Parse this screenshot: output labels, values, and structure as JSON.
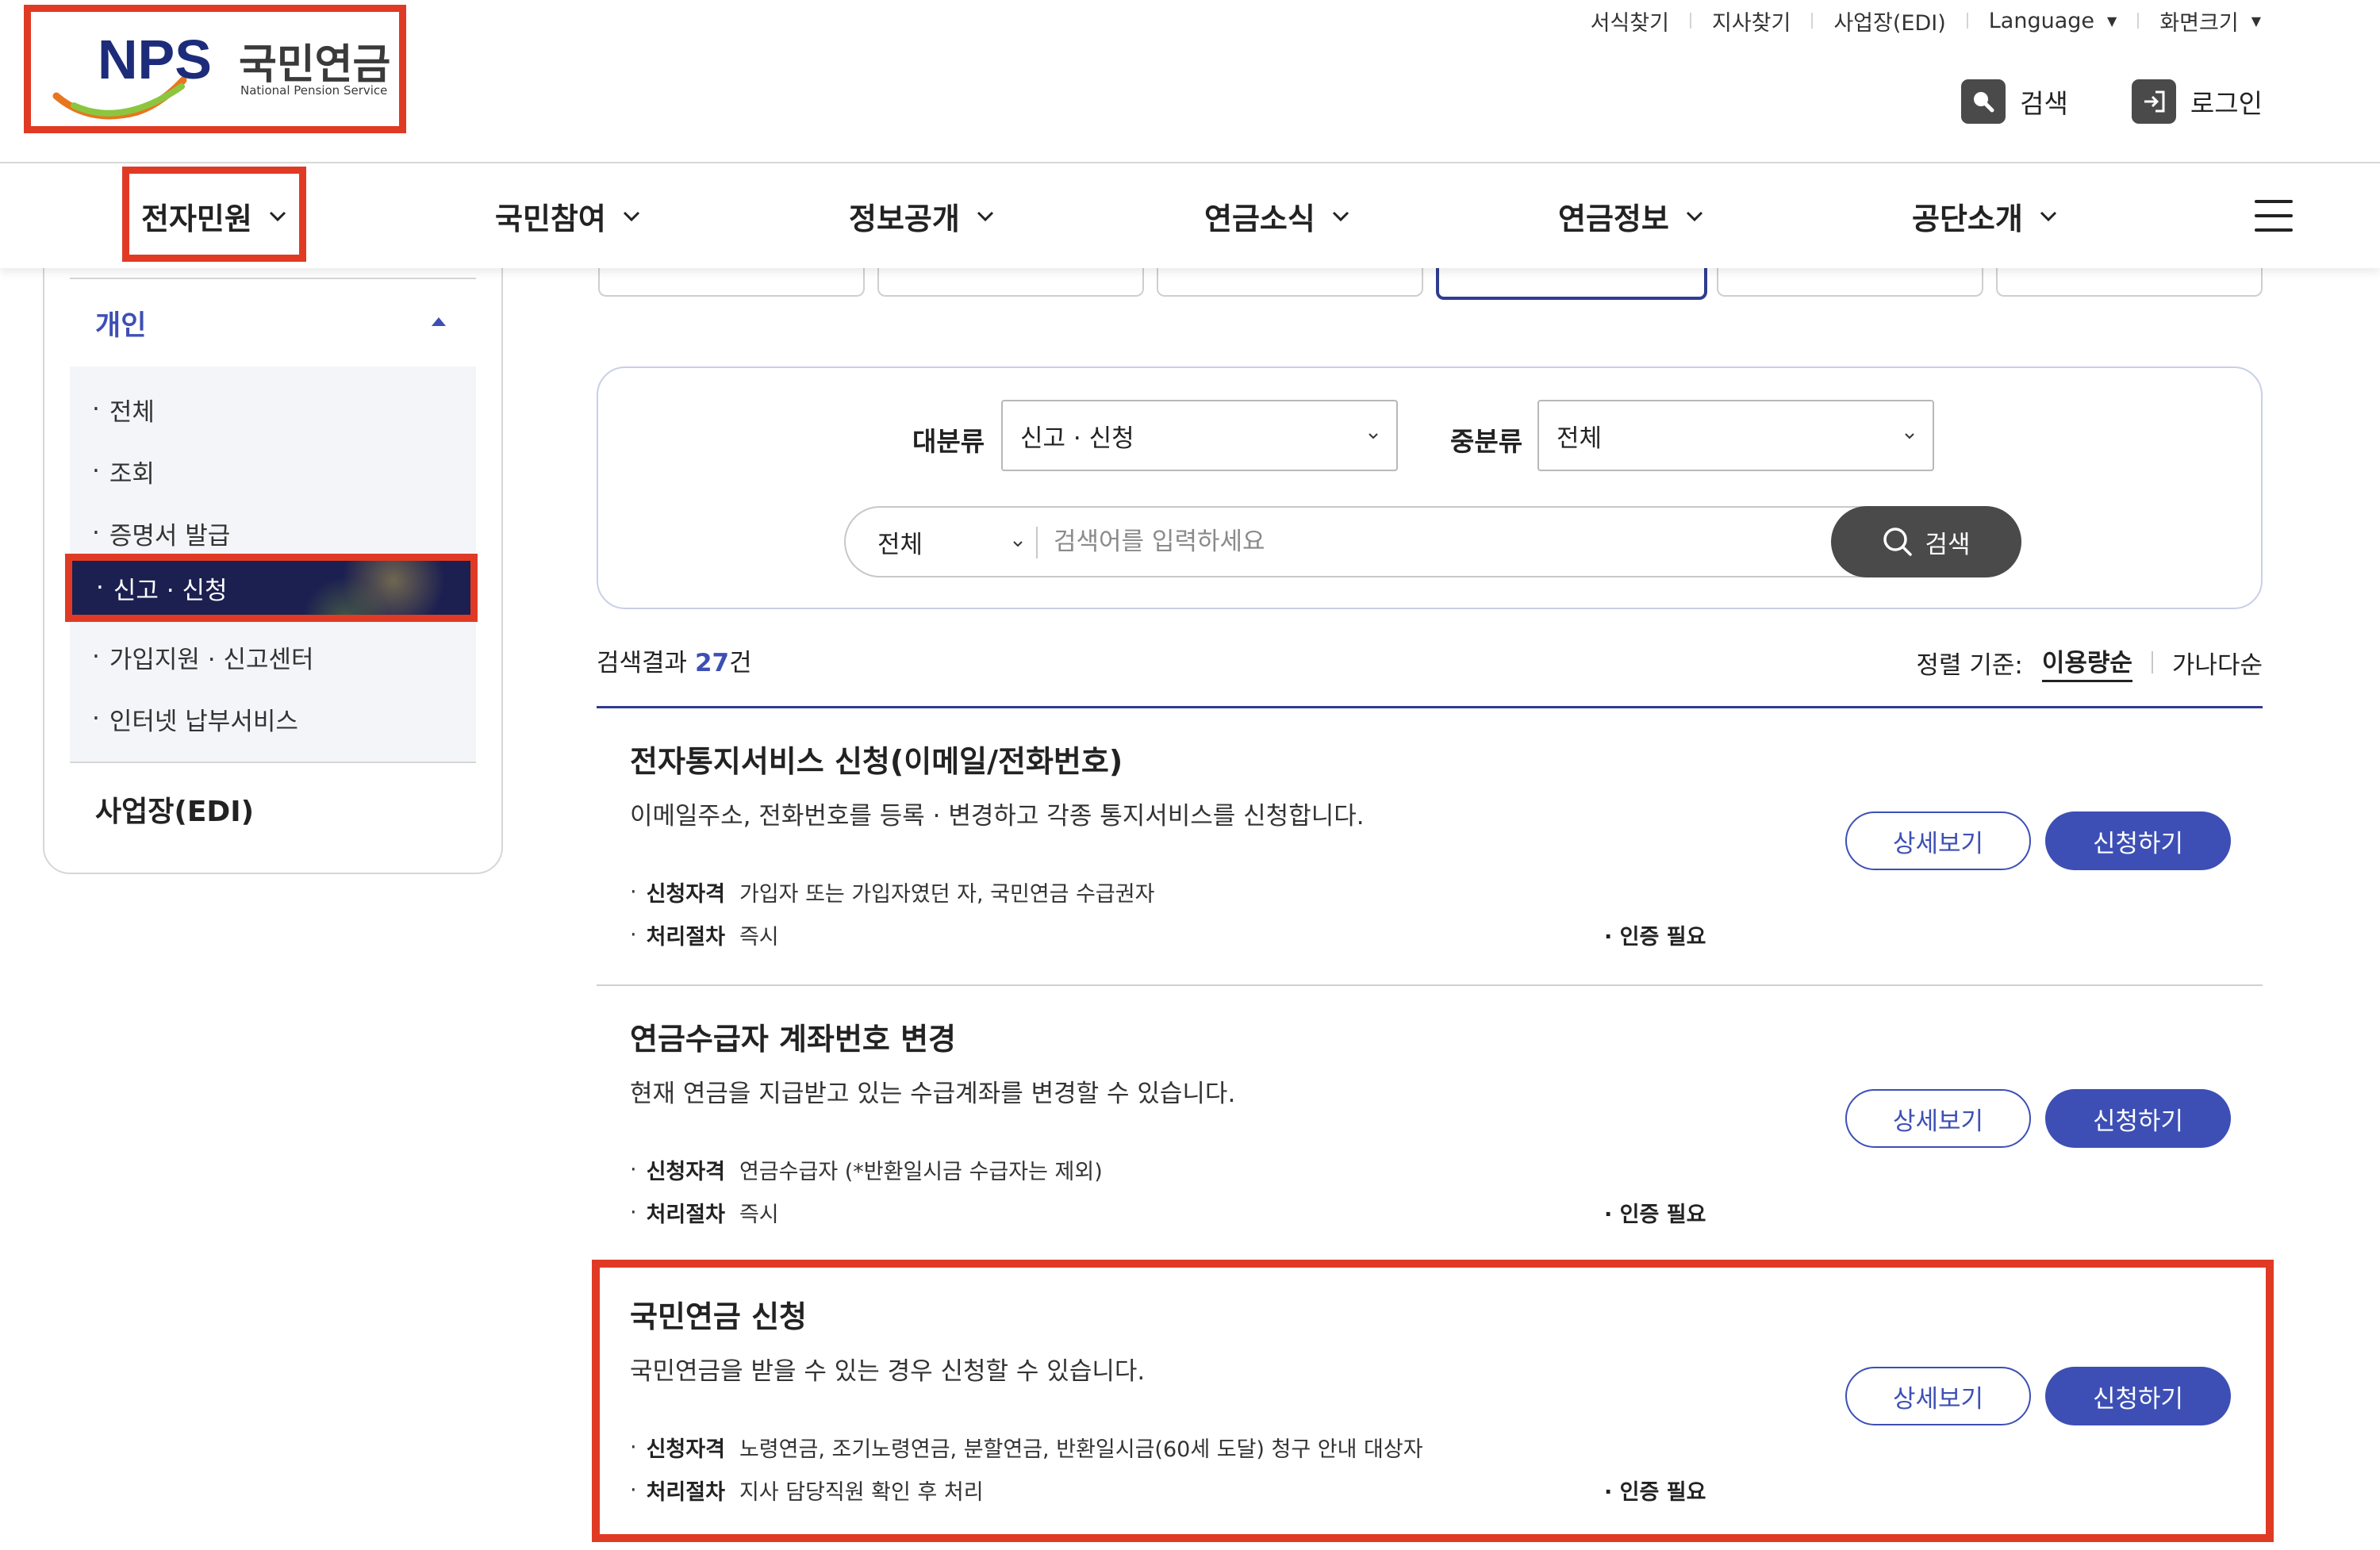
{
  "brand": {
    "logo_mark": "NPS",
    "logo_kr": "국민연금",
    "logo_en": "National Pension Service"
  },
  "utility_links": [
    {
      "label": "서식찾기",
      "has_caret": false
    },
    {
      "label": "지사찾기",
      "has_caret": false
    },
    {
      "label": "사업장(EDI)",
      "has_caret": false
    },
    {
      "label": "Language",
      "has_caret": true
    },
    {
      "label": "화면크기",
      "has_caret": true
    }
  ],
  "header_actions": {
    "search_label": "검색",
    "login_label": "로그인"
  },
  "gnb": [
    {
      "label": "전자민원"
    },
    {
      "label": "국민참여"
    },
    {
      "label": "정보공개"
    },
    {
      "label": "연금소식"
    },
    {
      "label": "연금정보"
    },
    {
      "label": "공단소개"
    }
  ],
  "sidebar": {
    "section_title": "개인",
    "items": [
      {
        "label": "전체"
      },
      {
        "label": "조회"
      },
      {
        "label": "증명서 발급"
      },
      {
        "label": "신고 · 신청"
      },
      {
        "label": "가입지원 · 신고센터"
      },
      {
        "label": "인터넷 납부서비스"
      }
    ],
    "active_index": 3,
    "second_section": "사업장(EDI)"
  },
  "filters": {
    "major_label": "대분류",
    "major_value": "신고 · 신청",
    "minor_label": "중분류",
    "minor_value": "전체",
    "scope_value": "전체",
    "search_placeholder": "검색어를 입력하세요",
    "search_button": "검색"
  },
  "results": {
    "prefix": "검색결과 ",
    "count": "27",
    "suffix": "건",
    "sort_label": "정렬 기준:",
    "sort_active": "이용량순",
    "sort_other": "가나다순"
  },
  "cards": [
    {
      "title": "전자통지서비스 신청(이메일/전화번호)",
      "desc": "이메일주소, 전화번호를 등록 · 변경하고 각종 통지서비스를 신청합니다.",
      "eligibility_label": "신청자격",
      "eligibility": "가입자 또는 가입자였던 자, 국민연금 수급권자",
      "process_label": "처리절차",
      "process": "즉시",
      "auth": "인증 필요",
      "detail_button": "상세보기",
      "apply_button": "신청하기"
    },
    {
      "title": "연금수급자 계좌번호 변경",
      "desc": "현재 연금을 지급받고 있는 수급계좌를 변경할 수 있습니다.",
      "eligibility_label": "신청자격",
      "eligibility": "연금수급자 (*반환일시금 수급자는 제외)",
      "process_label": "처리절차",
      "process": "즉시",
      "auth": "인증 필요",
      "detail_button": "상세보기",
      "apply_button": "신청하기"
    },
    {
      "title": "국민연금 신청",
      "desc": "국민연금을 받을 수 있는 경우 신청할 수 있습니다.",
      "eligibility_label": "신청자격",
      "eligibility": "노령연금, 조기노령연금, 분할연금, 반환일시금(60세 도달) 청구 안내 대상자",
      "process_label": "처리절차",
      "process": "지사 담당직원 확인 후 처리",
      "auth": "인증 필요",
      "detail_button": "상세보기",
      "apply_button": "신청하기"
    }
  ],
  "colors": {
    "primary": "#3d4fb5",
    "navy": "#1c2050",
    "highlight": "#e03a25",
    "dark_button": "#4a4a4a"
  }
}
